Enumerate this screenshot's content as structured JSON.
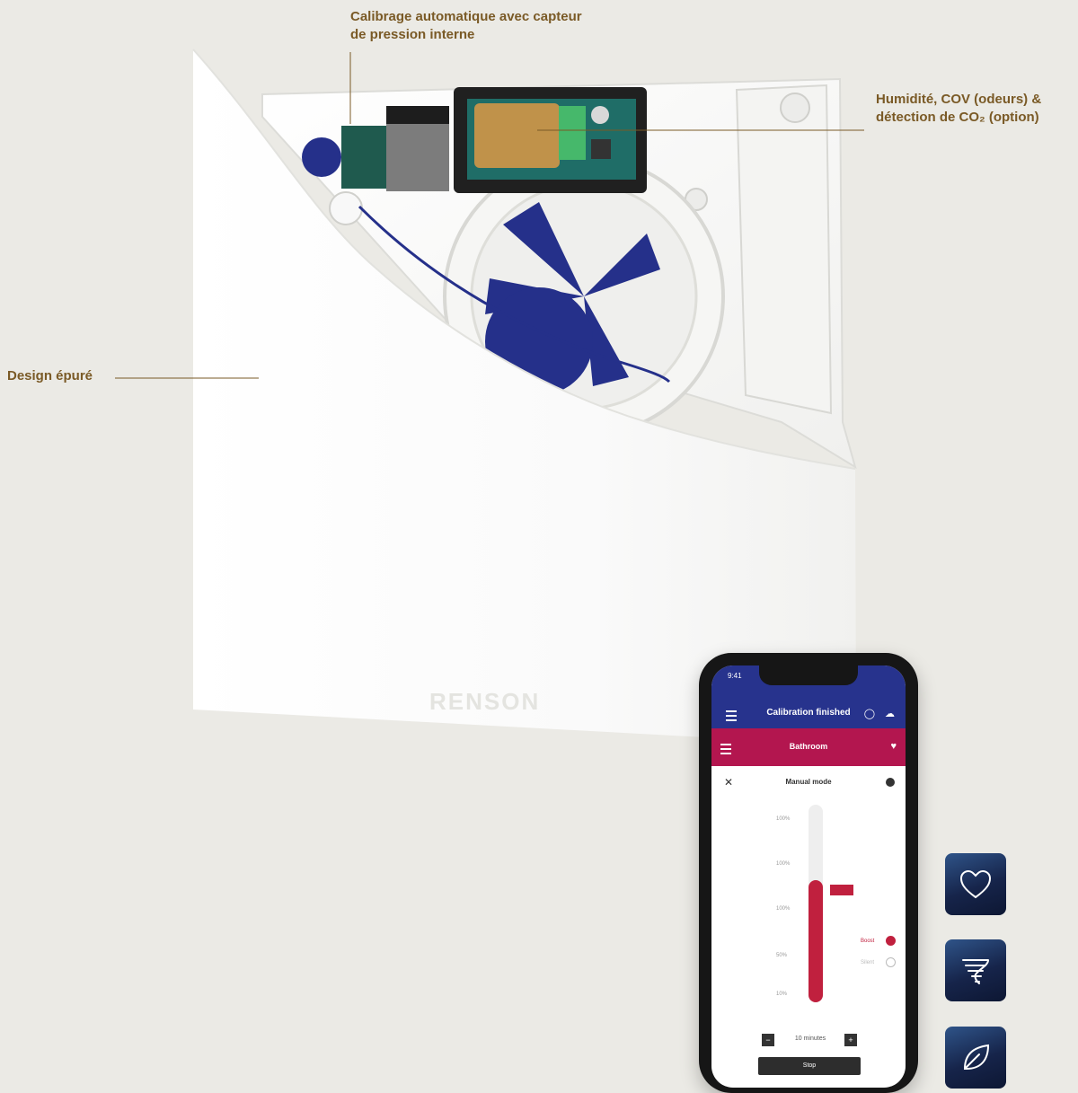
{
  "callouts": {
    "top": "Calibrage automatique avec capteur de pression interne",
    "right": "Humidité, COV (odeurs) & détection de CO₂ (option)",
    "left": "Design épuré"
  },
  "device": {
    "brand": "RENSON"
  },
  "phone": {
    "time": "9:41",
    "header_title": "Calibration finished",
    "room": "Bathroom",
    "mode_title": "Manual mode",
    "levels": [
      "100%",
      "100%",
      "100%",
      "50%",
      "10%"
    ],
    "slider_value": 0.62,
    "boost_label": "Boost",
    "eco_label": "Silent",
    "duration": "10 minutes",
    "stop_label": "Stop"
  },
  "tiles": [
    "heart-icon",
    "tornado-icon",
    "leaf-icon"
  ]
}
